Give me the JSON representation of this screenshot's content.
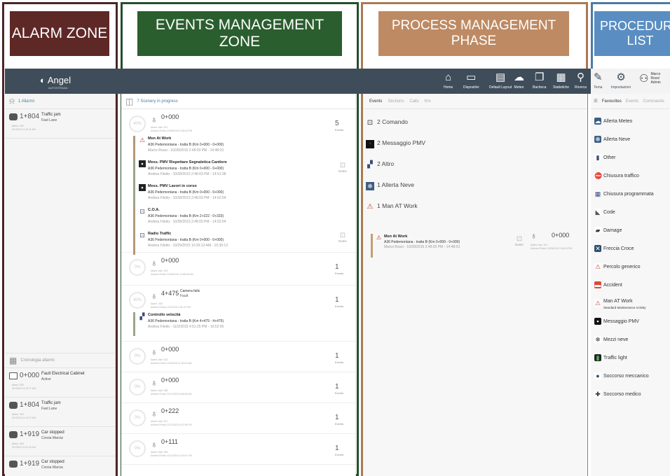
{
  "zones": {
    "alarm": "ALARM ZONE",
    "events": "EVENTS MANAGEMENT ZONE",
    "process": "PROCESS MANAGEMENT PHASE",
    "procedure": "PROCEDURE LIST"
  },
  "app": {
    "name": "Angel",
    "subtitle": "AUTOSTRADA"
  },
  "nav": [
    {
      "label": "Home",
      "icon": "home-icon",
      "glyph": "⌂"
    },
    {
      "label": "Dispositivi",
      "icon": "monitor-icon",
      "glyph": "▭"
    },
    {
      "label": "Default Layout",
      "icon": "layout-icon",
      "glyph": "▤"
    },
    {
      "label": "Meteo",
      "icon": "cloud-icon",
      "glyph": "☁"
    },
    {
      "label": "Bacheca",
      "icon": "board-icon",
      "glyph": "❐"
    },
    {
      "label": "Statistiche",
      "icon": "stats-icon",
      "glyph": "▦"
    },
    {
      "label": "Ricerca",
      "icon": "search-icon",
      "glyph": "⚲"
    }
  ],
  "nav_right": [
    {
      "label": "Tema",
      "icon": "theme-icon",
      "glyph": "✎"
    },
    {
      "label": "Impostazioni",
      "icon": "gear-icon",
      "glyph": "⚙"
    }
  ],
  "user": {
    "name": "Marco Rossi",
    "role": "Admin"
  },
  "alarm": {
    "header": "1 Allarmi",
    "items": [
      {
        "km": "1+804",
        "title": "Traffic jam",
        "desc": "Fast Lane",
        "meta1": "Alarm: 302",
        "meta2": "4/1/2016 11:15:11 AM"
      }
    ],
    "history_header": "Cronologia allarmi",
    "history": [
      {
        "km": "0+000",
        "title": "Fault Electrical Cabinet",
        "desc": "Active",
        "meta1": "Alarm: 300",
        "meta2": "4/1/2016 11:15:17 AM",
        "icon": "cabinet"
      },
      {
        "km": "1+804",
        "title": "Traffic jam",
        "desc": "Fast Lane",
        "meta1": "Alarm: 302",
        "meta2": "4/1/2016 11:12:17 AM",
        "icon": "camera"
      },
      {
        "km": "1+919",
        "title": "Car stopped",
        "desc": "Corsia Marcia",
        "meta1": "Alarm: 300",
        "meta2": "4/1/2016 11:11:16 AM",
        "icon": "camera"
      },
      {
        "km": "1+919",
        "title": "Car stopped",
        "desc": "Corsia Marcia",
        "meta1": "",
        "meta2": "",
        "icon": "camera"
      }
    ]
  },
  "events": {
    "header": "7 Scenery in progress",
    "notes_label": "Notes",
    "events_label": "Events",
    "blocks": [
      {
        "km": "0+000",
        "ring": "40%",
        "count": "5",
        "meta1": "Alarm User 101",
        "meta2": "Andrea Filotto 10/28/2015 2:48:03 PM",
        "subs": [
          {
            "icon": "warning",
            "t1": "Men At Work",
            "t2": "A36 Pedemontana - tratta B (Km 0+000 - 0+000)",
            "t3": "Marco Rossi - 10/28/2015 2:48:03 PM - 14:48:03"
          },
          {
            "icon": "pmv",
            "t1": "Mess. PMV Rispettare Segnaletica Cantiere",
            "t2": "A36 Pedemontana - tratta B (Km 0+000 - 0+000)",
            "t3": "Andrea Filotto - 10/28/2015 2:48:03 PM - 14:51:38"
          },
          {
            "icon": "pmv",
            "t1": "Mess. PMV Lavori in corso",
            "t2": "A36 Pedemontana - tratta B (Km 0+000 - 0+000)",
            "t3": "Andrea Filotto - 10/28/2015 2:48:03 PM - 14:52:04"
          },
          {
            "icon": "coa",
            "t1": "C.O.A.",
            "t2": "A36 Pedemontana - tratta B (Km 2+222 - 0+333)",
            "t3": "Andrea Filotto - 10/28/2015 2:48:03 PM - 14:52:04"
          },
          {
            "icon": "radio",
            "t1": "Radio Traffic",
            "t2": "A36 Pedemontana - tratta B (Km 0+000 - 0+000)",
            "t3": "Andrea Filotto - 10/29/2015 10:35:13 AM - 10:35:13"
          }
        ]
      },
      {
        "km": "0+000",
        "ring": "0%",
        "count": "1",
        "meta1": "Alarm User 103",
        "meta2": "Andrea Filotto 10/28/2015 11:58:54 AM"
      },
      {
        "km": "4+475",
        "ring": "40%",
        "count": "1",
        "title": "Camera fails",
        "sub": "Fault",
        "meta1": "Alarm: 206",
        "meta2": "Andrea Filotto 11/2/2015 4:51:20 PM",
        "subs": [
          {
            "icon": "altro",
            "t1": "Controllo velocità",
            "t2": "A36 Pedemontana - tratta B (Km 4+475 - 4+475)",
            "t3": "Andrea Filotto - 11/2/2015 4:51:25 PM - 16:52:00"
          }
        ]
      },
      {
        "km": "0+000",
        "ring": "0%",
        "count": "1",
        "meta1": "Alarm User 333",
        "meta2": "Andrea Filotto 11/3/2015 11:30:00 AM"
      },
      {
        "km": "0+000",
        "ring": "0%",
        "count": "1",
        "meta1": "Alarm User 338",
        "meta2": "Andrea Filotto 11/11/2015 8:48:05 AM"
      },
      {
        "km": "0+222",
        "ring": "0%",
        "count": "1",
        "meta1": "Alarm User 337",
        "meta2": "Andrea Filotto 11/11/2015 4:37:48 PM"
      },
      {
        "km": "0+111",
        "ring": "0%",
        "count": "1",
        "meta1": "Alarm User 338",
        "meta2": "Andrea Filotto 11/11/2015 4:43:41 PM"
      }
    ]
  },
  "process": {
    "tabs": [
      "Events",
      "Sections",
      "Calls",
      "Km"
    ],
    "items": [
      {
        "count": "2",
        "label": "Comando",
        "icon": "command"
      },
      {
        "count": "2",
        "label": "Messaggio PMV",
        "icon": "pmv"
      },
      {
        "count": "2",
        "label": "Altro",
        "icon": "altro"
      },
      {
        "count": "1",
        "label": "Allerta Neve",
        "icon": "snow"
      },
      {
        "count": "1",
        "label": "Man AT Work",
        "icon": "warning"
      }
    ],
    "detail": {
      "t1": "Men At Work",
      "t2": "A36 Pedemontana - tratta B (Km 0+000 - 0+000)",
      "t3": "Marco Rossi - 10/28/2015 2:48:03 PM - 14:48:03",
      "notes": "Notes",
      "km": "0+000",
      "meta1": "Alarm User 101",
      "meta2": "Andrea Filotto 10/28/2015 2:48:03 PM"
    }
  },
  "procedures": {
    "tabs": [
      "Favourites",
      "Events",
      "Commands"
    ],
    "items": [
      {
        "label": "Allerta Meteo",
        "icon": "weather-alert-icon",
        "glyph": "☁",
        "bg": "#3b5f86",
        "fg": "#ffffff"
      },
      {
        "label": "Allerta Neve",
        "icon": "snow-alert-icon",
        "glyph": "❄",
        "bg": "#3b5f86",
        "fg": "#ffffff"
      },
      {
        "label": "Other",
        "icon": "other-icon",
        "glyph": "▮",
        "bg": "#ffffff",
        "fg": "#3a4a7a"
      },
      {
        "label": "Chiusura traffico",
        "icon": "road-closed-icon",
        "glyph": "⛔",
        "bg": "#ffffff",
        "fg": "#c0392b"
      },
      {
        "label": "Chiusura programmata",
        "icon": "calendar-icon",
        "glyph": "▦",
        "bg": "#ffffff",
        "fg": "#3a4a7a"
      },
      {
        "label": "Code",
        "icon": "queue-icon",
        "glyph": "◣",
        "bg": "#ffffff",
        "fg": "#555555"
      },
      {
        "label": "Damage",
        "icon": "damage-icon",
        "glyph": "▰",
        "bg": "#ffffff",
        "fg": "#4a3a3a"
      },
      {
        "label": "Freccia Croce",
        "icon": "arrow-cross-icon",
        "glyph": "✕",
        "bg": "#2c4e6e",
        "fg": "#ffffff"
      },
      {
        "label": "Percolo generico",
        "icon": "warning-icon",
        "glyph": "⚠",
        "bg": "#ffffff",
        "fg": "#c0392b"
      },
      {
        "label": "Accident",
        "icon": "accident-icon",
        "glyph": "▬",
        "bg": "#d94a3a",
        "fg": "#ffffff"
      },
      {
        "label": "Man AT Work",
        "icon": "man-at-work-icon",
        "glyph": "⚠",
        "bg": "#ffffff",
        "fg": "#c0392b",
        "sub": "Standard Maintenance Activity"
      },
      {
        "label": "Messaggio PMV",
        "icon": "pmv-icon",
        "glyph": "▪",
        "bg": "#111111",
        "fg": "#ffffff"
      },
      {
        "label": "Mezzi neve",
        "icon": "snowplow-icon",
        "glyph": "❄",
        "bg": "#ffffff",
        "fg": "#333333"
      },
      {
        "label": "Traffic light",
        "icon": "traffic-light-icon",
        "glyph": "▮",
        "bg": "#222222",
        "fg": "#4caf50"
      },
      {
        "label": "Soccorso meccanico",
        "icon": "mechanic-icon",
        "glyph": "●",
        "bg": "#ffffff",
        "fg": "#2c4e6e"
      },
      {
        "label": "Soccorso medico",
        "icon": "ambulance-icon",
        "glyph": "✚",
        "bg": "#ffffff",
        "fg": "#333333"
      }
    ]
  }
}
